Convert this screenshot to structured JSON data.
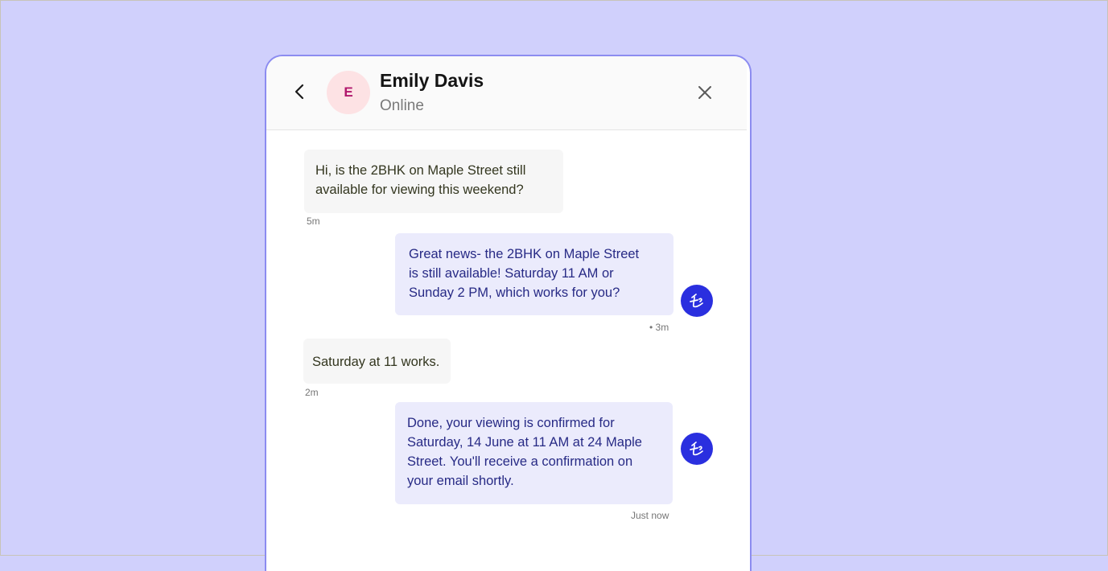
{
  "header": {
    "avatar_initial": "E",
    "name": "Emily Davis",
    "status": "Online",
    "back_icon": "chevron-left-icon",
    "close_icon": "close-icon"
  },
  "messages": [
    {
      "sender": "user",
      "lines": [
        "Hi, is the 2BHK on Maple Street still",
        "available for viewing this weekend?"
      ],
      "time": "5m"
    },
    {
      "sender": "agent",
      "lines": [
        "Great news- the 2BHK on Maple Street",
        "is still available! Saturday 11 AM or",
        "Sunday 2 PM, which works for you?"
      ],
      "time": "• 3m"
    },
    {
      "sender": "user",
      "lines": [
        "Saturday at 11 works."
      ],
      "time": "2m"
    },
    {
      "sender": "agent",
      "lines": [
        "Done, your viewing is confirmed for",
        "Saturday, 14 June at 11 AM at 24 Maple",
        "Street. You'll receive a confirmation on",
        "your email shortly."
      ],
      "time": "Just now"
    }
  ],
  "colors": {
    "page_background": "#d0d0fc",
    "panel_border": "#8c8cf0",
    "avatar_background": "#fde2e4",
    "avatar_text": "#b0176c",
    "incoming_bubble": "#f6f6f6",
    "outgoing_bubble": "#ebebfc",
    "outgoing_text": "#272a85",
    "agent_avatar": "#2a2fdf"
  },
  "agent_avatar_icon": "agent-logo-icon"
}
